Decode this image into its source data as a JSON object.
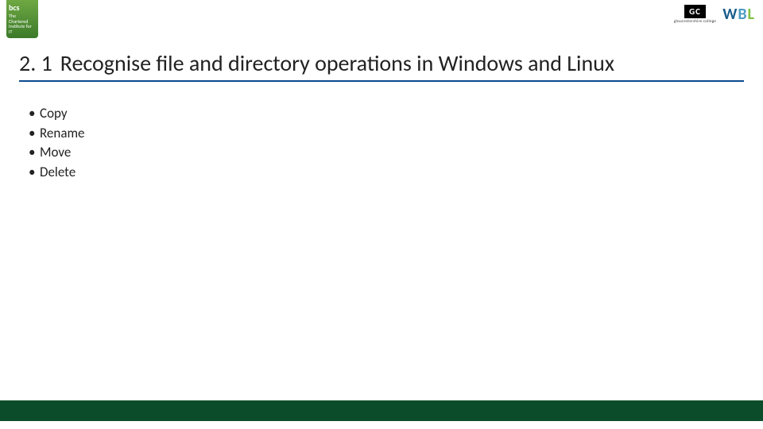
{
  "logos": {
    "bcs": {
      "main": "bcs",
      "tagline": "The Chartered Institute for IT"
    },
    "gc": {
      "text": "GC",
      "sub": "gloucestershire college"
    },
    "wbl": {
      "w": "W",
      "b": "B",
      "l": "L"
    }
  },
  "heading": {
    "number": "2. 1",
    "title": "Recognise file and directory operations in Windows and Linux"
  },
  "bullets": [
    "Copy",
    "Rename",
    "Move",
    "Delete"
  ]
}
